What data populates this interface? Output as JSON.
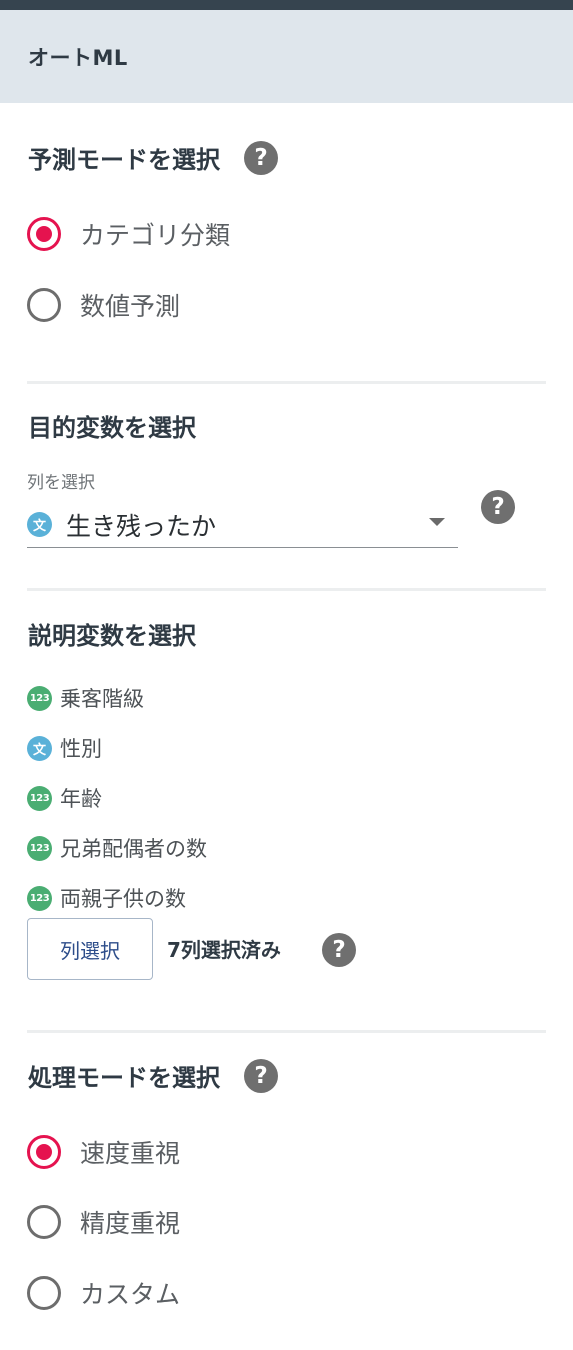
{
  "header": {
    "title": "オートML"
  },
  "prediction_mode": {
    "title": "予測モードを選択",
    "help_glyph": "?",
    "options": [
      {
        "label": "カテゴリ分類",
        "checked": true
      },
      {
        "label": "数値予測",
        "checked": false
      }
    ]
  },
  "target_variable": {
    "title": "目的変数を選択",
    "select_label": "列を選択",
    "selected_value": "生き残ったか",
    "selected_type_badge": "文",
    "help_glyph": "?"
  },
  "explanatory_variables": {
    "title": "説明変数を選択",
    "items": [
      {
        "badge": "123",
        "type": "num",
        "name": "乗客階級"
      },
      {
        "badge": "文",
        "type": "text",
        "name": "性別"
      },
      {
        "badge": "123",
        "type": "num",
        "name": "年齢"
      },
      {
        "badge": "123",
        "type": "num",
        "name": "兄弟配偶者の数"
      },
      {
        "badge": "123",
        "type": "num",
        "name": "両親子供の数"
      }
    ],
    "select_button_label": "列選択",
    "selected_count_text": "7列選択済み",
    "help_glyph": "?"
  },
  "processing_mode": {
    "title": "処理モードを選択",
    "help_glyph": "?",
    "options": [
      {
        "label": "速度重視",
        "checked": true
      },
      {
        "label": "精度重視",
        "checked": false
      },
      {
        "label": "カスタム",
        "checked": false
      }
    ]
  },
  "colors": {
    "accent_radio": "#e5134f",
    "header_bg": "#dfe6ec",
    "topbar": "#36444f",
    "badge_text": "#5ab1d8",
    "badge_num": "#4aad72"
  }
}
